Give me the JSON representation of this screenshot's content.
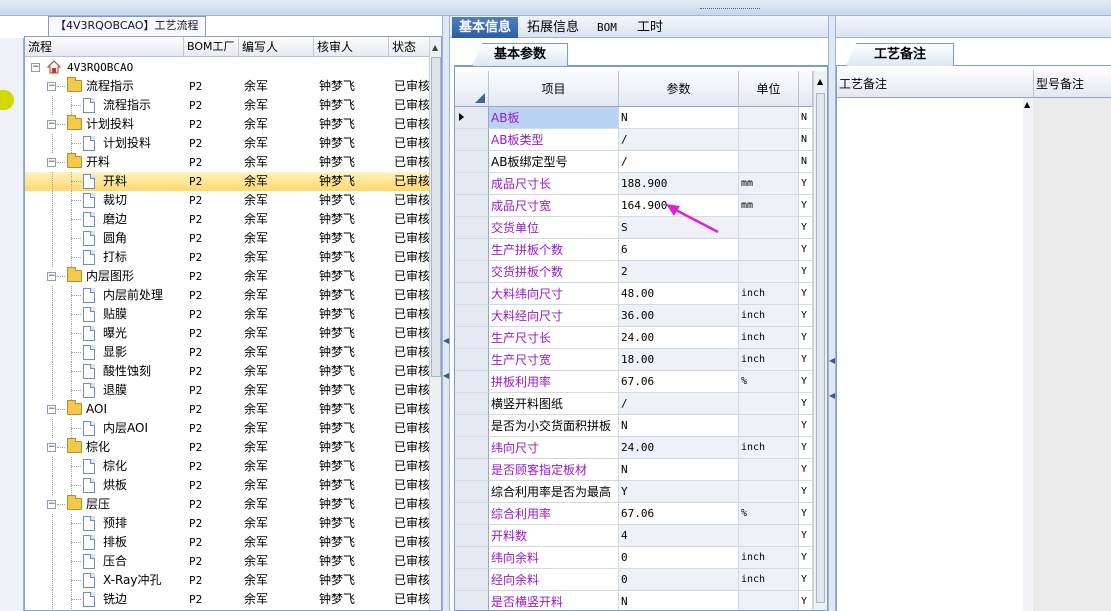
{
  "window": {
    "tree_title": "【4V3RQOBCAO】工艺流程"
  },
  "tree": {
    "columns": [
      "流程",
      "BOM工厂",
      "编写人",
      "核审人",
      "状态"
    ],
    "rows": [
      {
        "name": "4V3RQOBCAO",
        "level": 0,
        "type": "root",
        "bom": "",
        "author": "",
        "reviewer": "",
        "status": ""
      },
      {
        "name": "流程指示",
        "level": 1,
        "type": "folder",
        "bom": "P2",
        "author": "余军",
        "reviewer": "钟梦飞",
        "status": "已审核"
      },
      {
        "name": "流程指示",
        "level": 2,
        "type": "doc",
        "bom": "P2",
        "author": "余军",
        "reviewer": "钟梦飞",
        "status": "已审核"
      },
      {
        "name": "计划投料",
        "level": 1,
        "type": "folder",
        "bom": "P2",
        "author": "余军",
        "reviewer": "钟梦飞",
        "status": "已审核"
      },
      {
        "name": "计划投料",
        "level": 2,
        "type": "doc",
        "bom": "P2",
        "author": "余军",
        "reviewer": "钟梦飞",
        "status": "已审核"
      },
      {
        "name": "开料",
        "level": 1,
        "type": "folder",
        "bom": "P2",
        "author": "余军",
        "reviewer": "钟梦飞",
        "status": "已审核"
      },
      {
        "name": "开料",
        "level": 2,
        "type": "doc",
        "bom": "P2",
        "author": "余军",
        "reviewer": "钟梦飞",
        "status": "已审核",
        "selected": true
      },
      {
        "name": "裁切",
        "level": 2,
        "type": "doc",
        "bom": "P2",
        "author": "余军",
        "reviewer": "钟梦飞",
        "status": "已审核"
      },
      {
        "name": "磨边",
        "level": 2,
        "type": "doc",
        "bom": "P2",
        "author": "余军",
        "reviewer": "钟梦飞",
        "status": "已审核"
      },
      {
        "name": "圆角",
        "level": 2,
        "type": "doc",
        "bom": "P2",
        "author": "余军",
        "reviewer": "钟梦飞",
        "status": "已审核"
      },
      {
        "name": "打标",
        "level": 2,
        "type": "doc",
        "bom": "P2",
        "author": "余军",
        "reviewer": "钟梦飞",
        "status": "已审核"
      },
      {
        "name": "内层图形",
        "level": 1,
        "type": "folder",
        "bom": "P2",
        "author": "余军",
        "reviewer": "钟梦飞",
        "status": "已审核"
      },
      {
        "name": "内层前处理",
        "level": 2,
        "type": "doc",
        "bom": "P2",
        "author": "余军",
        "reviewer": "钟梦飞",
        "status": "已审核"
      },
      {
        "name": "贴膜",
        "level": 2,
        "type": "doc",
        "bom": "P2",
        "author": "余军",
        "reviewer": "钟梦飞",
        "status": "已审核"
      },
      {
        "name": "曝光",
        "level": 2,
        "type": "doc",
        "bom": "P2",
        "author": "余军",
        "reviewer": "钟梦飞",
        "status": "已审核"
      },
      {
        "name": "显影",
        "level": 2,
        "type": "doc",
        "bom": "P2",
        "author": "余军",
        "reviewer": "钟梦飞",
        "status": "已审核"
      },
      {
        "name": "酸性蚀刻",
        "level": 2,
        "type": "doc",
        "bom": "P2",
        "author": "余军",
        "reviewer": "钟梦飞",
        "status": "已审核"
      },
      {
        "name": "退膜",
        "level": 2,
        "type": "doc",
        "bom": "P2",
        "author": "余军",
        "reviewer": "钟梦飞",
        "status": "已审核"
      },
      {
        "name": "AOI",
        "level": 1,
        "type": "folder",
        "bom": "P2",
        "author": "余军",
        "reviewer": "钟梦飞",
        "status": "已审核"
      },
      {
        "name": "内层AOI",
        "level": 2,
        "type": "doc",
        "bom": "P2",
        "author": "余军",
        "reviewer": "钟梦飞",
        "status": "已审核"
      },
      {
        "name": "棕化",
        "level": 1,
        "type": "folder",
        "bom": "P2",
        "author": "余军",
        "reviewer": "钟梦飞",
        "status": "已审核"
      },
      {
        "name": "棕化",
        "level": 2,
        "type": "doc",
        "bom": "P2",
        "author": "余军",
        "reviewer": "钟梦飞",
        "status": "已审核"
      },
      {
        "name": "烘板",
        "level": 2,
        "type": "doc",
        "bom": "P2",
        "author": "余军",
        "reviewer": "钟梦飞",
        "status": "已审核"
      },
      {
        "name": "层压",
        "level": 1,
        "type": "folder",
        "bom": "P2",
        "author": "余军",
        "reviewer": "钟梦飞",
        "status": "已审核"
      },
      {
        "name": "预排",
        "level": 2,
        "type": "doc",
        "bom": "P2",
        "author": "余军",
        "reviewer": "钟梦飞",
        "status": "已审核"
      },
      {
        "name": "排板",
        "level": 2,
        "type": "doc",
        "bom": "P2",
        "author": "余军",
        "reviewer": "钟梦飞",
        "status": "已审核"
      },
      {
        "name": "压合",
        "level": 2,
        "type": "doc",
        "bom": "P2",
        "author": "余军",
        "reviewer": "钟梦飞",
        "status": "已审核"
      },
      {
        "name": "X-Ray冲孔",
        "level": 2,
        "type": "doc",
        "bom": "P2",
        "author": "余军",
        "reviewer": "钟梦飞",
        "status": "已审核"
      },
      {
        "name": "铣边",
        "level": 2,
        "type": "doc",
        "bom": "P2",
        "author": "余军",
        "reviewer": "钟梦飞",
        "status": "已审核"
      }
    ]
  },
  "main_tabs": [
    "基本信息",
    "拓展信息",
    "BOM",
    "工时"
  ],
  "sub_tab": "基本参数",
  "grid": {
    "columns": [
      "项目",
      "参数",
      "单位"
    ],
    "rows": [
      {
        "item": "AB板",
        "param": "N",
        "unit": "",
        "flag": "N",
        "purple": true,
        "selected": true
      },
      {
        "item": "AB板类型",
        "param": "/",
        "unit": "",
        "flag": "N",
        "purple": true
      },
      {
        "item": "AB板绑定型号",
        "param": "/",
        "unit": "",
        "flag": "N",
        "purple": false
      },
      {
        "item": "成品尺寸长",
        "param": "188.900",
        "unit": "mm",
        "flag": "Y",
        "purple": true
      },
      {
        "item": "成品尺寸宽",
        "param": "164.900",
        "unit": "mm",
        "flag": "Y",
        "purple": true
      },
      {
        "item": "交货单位",
        "param": "S",
        "unit": "",
        "flag": "Y",
        "purple": true
      },
      {
        "item": "生产拼板个数",
        "param": "6",
        "unit": "",
        "flag": "Y",
        "purple": true
      },
      {
        "item": "交货拼板个数",
        "param": "2",
        "unit": "",
        "flag": "Y",
        "purple": true
      },
      {
        "item": "大料纬向尺寸",
        "param": "48.00",
        "unit": "inch",
        "flag": "Y",
        "purple": true
      },
      {
        "item": "大料经向尺寸",
        "param": "36.00",
        "unit": "inch",
        "flag": "Y",
        "purple": true
      },
      {
        "item": "生产尺寸长",
        "param": "24.00",
        "unit": "inch",
        "flag": "Y",
        "purple": true
      },
      {
        "item": "生产尺寸宽",
        "param": "18.00",
        "unit": "inch",
        "flag": "Y",
        "purple": true
      },
      {
        "item": "拼板利用率",
        "param": "67.06",
        "unit": "%",
        "flag": "Y",
        "purple": true
      },
      {
        "item": "横竖开料图纸",
        "param": "/",
        "unit": "",
        "flag": "Y",
        "purple": false
      },
      {
        "item": "是否为小交货面积拼板",
        "param": "N",
        "unit": "",
        "flag": "Y",
        "purple": false
      },
      {
        "item": "纬向尺寸",
        "param": "24.00",
        "unit": "inch",
        "flag": "Y",
        "purple": true
      },
      {
        "item": "是否顾客指定板材",
        "param": "N",
        "unit": "",
        "flag": "Y",
        "purple": true
      },
      {
        "item": "综合利用率是否为最高",
        "param": "Y",
        "unit": "",
        "flag": "Y",
        "purple": false
      },
      {
        "item": "综合利用率",
        "param": "67.06",
        "unit": "%",
        "flag": "Y",
        "purple": true
      },
      {
        "item": "开料数",
        "param": "4",
        "unit": "",
        "flag": "Y",
        "purple": true
      },
      {
        "item": "纬向余料",
        "param": "0",
        "unit": "inch",
        "flag": "Y",
        "purple": true
      },
      {
        "item": "经向余料",
        "param": "0",
        "unit": "inch",
        "flag": "Y",
        "purple": true
      },
      {
        "item": "是否横竖开料",
        "param": "N",
        "unit": "",
        "flag": "Y",
        "purple": true
      }
    ]
  },
  "remarks": {
    "tab": "工艺备注",
    "columns": [
      "工艺备注",
      "型号备注"
    ]
  },
  "colors": {
    "purple_text": "#9a1ac8",
    "selected_row": "#ffd86b",
    "active_tab": "#2c5ea6",
    "annotation": "#e020d8"
  }
}
